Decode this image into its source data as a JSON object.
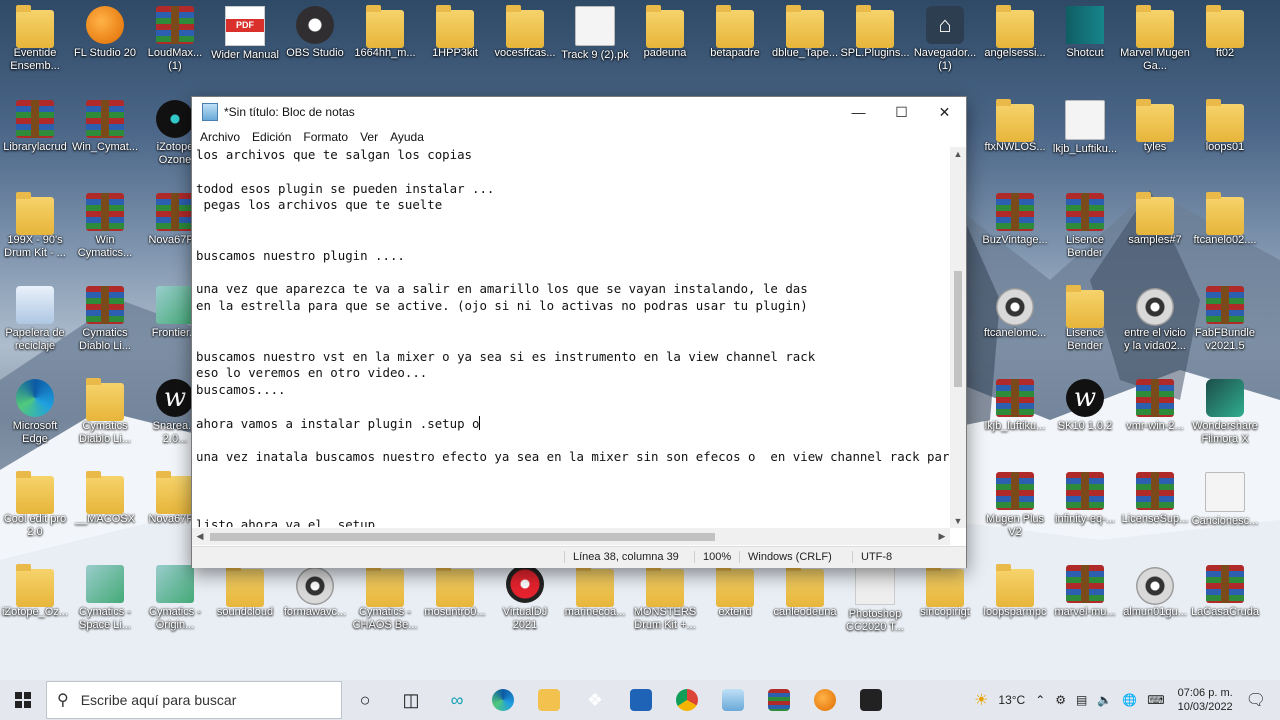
{
  "desktop": {
    "icons": [
      {
        "label": "Eventide Ensemb...",
        "kind": "folder"
      },
      {
        "label": "FL Studio 20",
        "kind": "fl"
      },
      {
        "label": "LoudMax... (1)",
        "kind": "rar"
      },
      {
        "label": "Wider Manual",
        "kind": "pdf"
      },
      {
        "label": "OBS Studio",
        "kind": "obs"
      },
      {
        "label": "1664hh_m...",
        "kind": "folder"
      },
      {
        "label": "1HPP3kit",
        "kind": "folder"
      },
      {
        "label": "vocesffcas...",
        "kind": "folder"
      },
      {
        "label": "Track 9 (2).pk",
        "kind": "file"
      },
      {
        "label": "padeuna",
        "kind": "folder"
      },
      {
        "label": "betapadre",
        "kind": "folder"
      },
      {
        "label": "dblue_Tape...",
        "kind": "folder"
      },
      {
        "label": "SPL.Plugins...",
        "kind": "folder"
      },
      {
        "label": "Navegador... (1)",
        "kind": "shield"
      },
      {
        "label": "angelsessi...",
        "kind": "folder"
      },
      {
        "label": "Shotcut",
        "kind": "shotcut"
      },
      {
        "label": "Marvel Mugen Ga...",
        "kind": "folder"
      },
      {
        "label": "ft02",
        "kind": "folder"
      },
      {
        "label": "Librarylacrud",
        "kind": "rar"
      },
      {
        "label": "Win_Cymat...",
        "kind": "rar"
      },
      {
        "label": "iZotope Ozone",
        "kind": "izotope"
      },
      {
        "label": "ftxNWLOS...",
        "kind": "folder"
      },
      {
        "label": "lkjb_Luftiku...",
        "kind": "file"
      },
      {
        "label": "tyles",
        "kind": "folder"
      },
      {
        "label": "loops01",
        "kind": "folder"
      },
      {
        "label": "199X - 90's Drum Kit - ...",
        "kind": "folder"
      },
      {
        "label": "Win Cymatics...",
        "kind": "rar"
      },
      {
        "label": "Nova67P...",
        "kind": "rar"
      },
      {
        "label": "BuzVintage...",
        "kind": "rar"
      },
      {
        "label": "Lisence Bender",
        "kind": "rar"
      },
      {
        "label": "samples#7",
        "kind": "folder"
      },
      {
        "label": "ftcanelo02....",
        "kind": "folder"
      },
      {
        "label": "Papelera de reciclaje",
        "kind": "recycle"
      },
      {
        "label": "Cymatics Diablo Li...",
        "kind": "rar"
      },
      {
        "label": "Frontier...",
        "kind": "setup"
      },
      {
        "label": "ftcanelomc...",
        "kind": "disc"
      },
      {
        "label": "Lisence Bender",
        "kind": "folder"
      },
      {
        "label": "entre el vicio y la vida02...",
        "kind": "disc"
      },
      {
        "label": "FabFBundle v2021.5",
        "kind": "rar"
      },
      {
        "label": "Microsoft Edge",
        "kind": "edge"
      },
      {
        "label": "Cymatics Diablo Li...",
        "kind": "folder"
      },
      {
        "label": "Snarea... 2.0...",
        "kind": "w"
      },
      {
        "label": "lkjb_luftiku...",
        "kind": "rar"
      },
      {
        "label": "SK10 1.0.2",
        "kind": "w"
      },
      {
        "label": "vmr-win-2...",
        "kind": "rar"
      },
      {
        "label": "Wondershare Filmora X",
        "kind": "filmora"
      },
      {
        "label": "Cool edit pro 2.0",
        "kind": "folder"
      },
      {
        "label": "__MACOSX",
        "kind": "folder"
      },
      {
        "label": "Nova67P...",
        "kind": "folder"
      },
      {
        "label": "Mugen Plus V2",
        "kind": "rar"
      },
      {
        "label": "infinity-eq-...",
        "kind": "rar"
      },
      {
        "label": "LicenseSup...",
        "kind": "rar"
      },
      {
        "label": "Cancionesc...",
        "kind": "file"
      },
      {
        "label": "iZotope_Oz...",
        "kind": "folder"
      },
      {
        "label": "Cymatics - Space Li...",
        "kind": "setup"
      },
      {
        "label": "Cymatics - Origin...",
        "kind": "setup"
      },
      {
        "label": "soundcloud",
        "kind": "folder"
      },
      {
        "label": "formawavc...",
        "kind": "disc"
      },
      {
        "label": "Cymatics - CHAOS Be...",
        "kind": "folder"
      },
      {
        "label": "mosuntro0...",
        "kind": "folder"
      },
      {
        "label": "VirtualDJ 2021",
        "kind": "vdj"
      },
      {
        "label": "marinecoa...",
        "kind": "folder"
      },
      {
        "label": "MONSTERS Drum Kit +...",
        "kind": "folder"
      },
      {
        "label": "extend",
        "kind": "folder"
      },
      {
        "label": "canleodeuna",
        "kind": "folder"
      },
      {
        "label": "Photoshop CC2020 T...",
        "kind": "ps"
      },
      {
        "label": "sincopirigt",
        "kind": "folder"
      },
      {
        "label": "loopsparmpc",
        "kind": "folder"
      },
      {
        "label": "marvel-mu...",
        "kind": "rar"
      },
      {
        "label": "almun01gu...",
        "kind": "disc"
      },
      {
        "label": "LaCasaCruda",
        "kind": "rar"
      }
    ]
  },
  "notepad": {
    "title": "*Sin título: Bloc de notas",
    "menu": [
      "Archivo",
      "Edición",
      "Formato",
      "Ver",
      "Ayuda"
    ],
    "lines": [
      "los archivos que te salgan los copias",
      "",
      "todod esos plugin se pueden instalar ...",
      " pegas los archivos que te suelte",
      "",
      "",
      "buscamos nuestro plugin ....",
      "",
      "una vez que aparezca te va a salir en amarillo los que se vayan instalando, le das",
      "en la estrella para que se active. (ojo si ni lo activas no podras usar tu plugin)",
      "",
      "",
      "buscamos nuestro vst en la mixer o ya sea si es instrumento en la view channel rack",
      "eso lo veremos en otro video...",
      "buscamos....",
      "",
      "ahora vamos a instalar plugin .setup o",
      "",
      "una vez inatala buscamos nuestro efecto ya sea en la mixer sin son efecos o  en view channel rack par",
      "",
      "",
      "",
      "listo ahora va el .setup"
    ],
    "status": {
      "position": "Línea 38, columna 39",
      "zoom": "100%",
      "line_ending": "Windows (CRLF)",
      "encoding": "UTF-8"
    }
  },
  "taskbar": {
    "search_placeholder": "Escribe aquí para buscar",
    "weather": "13°C",
    "time": "07:06 p. m.",
    "date": "10/03/2022"
  }
}
